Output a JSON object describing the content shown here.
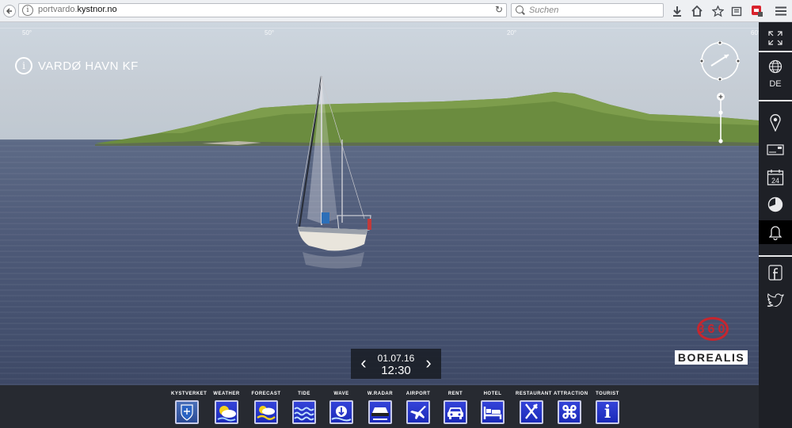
{
  "browser": {
    "url_prefix": "portvardo.",
    "url_domain": "kystnor.no",
    "search_placeholder": "Suchen"
  },
  "panorama": {
    "location_name": "VARDØ HAVN KF",
    "degrees": [
      "50°",
      "50°",
      "20°",
      "60°"
    ],
    "date": "01.07.16",
    "time": "12:30",
    "logo_number": "360",
    "logo_name": "BOREALIS"
  },
  "sidebar": {
    "language": "DE"
  },
  "bottom_menu": [
    {
      "label": "KYSTVERKET",
      "icon": "crest-icon"
    },
    {
      "label": "WEATHER",
      "icon": "weather-icon"
    },
    {
      "label": "FORECAST",
      "icon": "forecast-icon"
    },
    {
      "label": "TIDE",
      "icon": "tide-icon"
    },
    {
      "label": "WAVE",
      "icon": "wave-icon"
    },
    {
      "label": "W.RADAR",
      "icon": "radar-icon"
    },
    {
      "label": "AIRPORT",
      "icon": "airplane-icon"
    },
    {
      "label": "RENT",
      "icon": "car-icon"
    },
    {
      "label": "HOTEL",
      "icon": "bed-icon"
    },
    {
      "label": "RESTAURANT",
      "icon": "cutlery-icon"
    },
    {
      "label": "ATTRACTION",
      "icon": "command-icon"
    },
    {
      "label": "TOURIST",
      "icon": "info-icon"
    }
  ],
  "colors": {
    "menu_icon_blue": "#2535c9",
    "logo_red": "#c6262e",
    "sidebar_bg": "#1e2026"
  }
}
